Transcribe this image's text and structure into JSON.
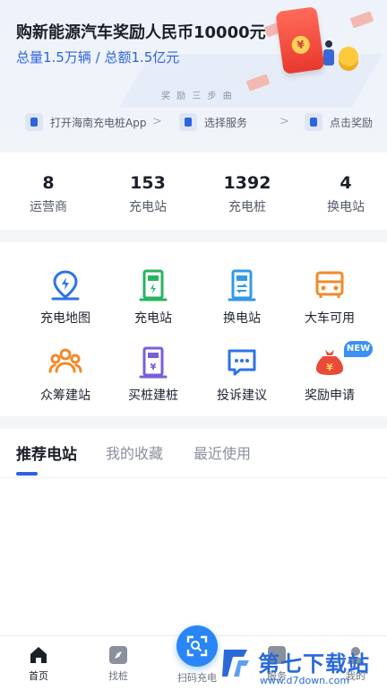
{
  "banner": {
    "title": "购新能源汽车奖励人民币10000元",
    "subtitle": "总量1.5万辆 / 总额1.5亿元",
    "steps_tag": "奖 励 三 步 曲",
    "coin_symbol": "¥",
    "flow": [
      {
        "label": "打开海南充电桩App",
        "icon": "phone-icon"
      },
      {
        "label": "选择服务",
        "icon": "service-icon"
      },
      {
        "label": "点击奖励",
        "icon": "reward-bag-icon"
      }
    ],
    "flow_arrow": ">"
  },
  "stats": [
    {
      "num": "8",
      "label": "运营商"
    },
    {
      "num": "153",
      "label": "充电站"
    },
    {
      "num": "1392",
      "label": "充电桩"
    },
    {
      "num": "4",
      "label": "换电站"
    }
  ],
  "grid": [
    {
      "label": "充电地图",
      "icon": "map-pin-icon",
      "color": "#2d73e6"
    },
    {
      "label": "充电站",
      "icon": "charging-pile-icon",
      "color": "#27b45f"
    },
    {
      "label": "换电站",
      "icon": "battery-swap-icon",
      "color": "#2f9ae8"
    },
    {
      "label": "大车可用",
      "icon": "truck-icon",
      "color": "#f18a2a"
    },
    {
      "label": "众筹建站",
      "icon": "crowdfund-icon",
      "color": "#f18a2a"
    },
    {
      "label": "买桩建桩",
      "icon": "buy-pile-icon",
      "color": "#7a5ed8"
    },
    {
      "label": "投诉建议",
      "icon": "chat-icon",
      "color": "#2d73e6"
    },
    {
      "label": "奖励申请",
      "icon": "money-bag-icon",
      "color": "#ea4a3a"
    }
  ],
  "new_badge": "NEW",
  "tabs": [
    {
      "label": "推荐电站",
      "active": true
    },
    {
      "label": "我的收藏",
      "active": false
    },
    {
      "label": "最近使用",
      "active": false
    }
  ],
  "bottombar": {
    "items": [
      {
        "label": "首页",
        "icon": "home-icon",
        "active": true
      },
      {
        "label": "找桩",
        "icon": "compass-icon",
        "active": false
      },
      {
        "label": "扫码充电",
        "icon": "scan-icon",
        "active": false
      },
      {
        "label": "服务",
        "icon": "service-grid-icon",
        "active": false
      },
      {
        "label": "我的",
        "icon": "user-icon",
        "active": false
      }
    ]
  },
  "watermark": {
    "text": "第七下载站",
    "url": "www.d7down.com"
  },
  "colors": {
    "accent": "#2d63e1",
    "scan_button": "#2a86f7",
    "badge": "#3b8ff5"
  }
}
